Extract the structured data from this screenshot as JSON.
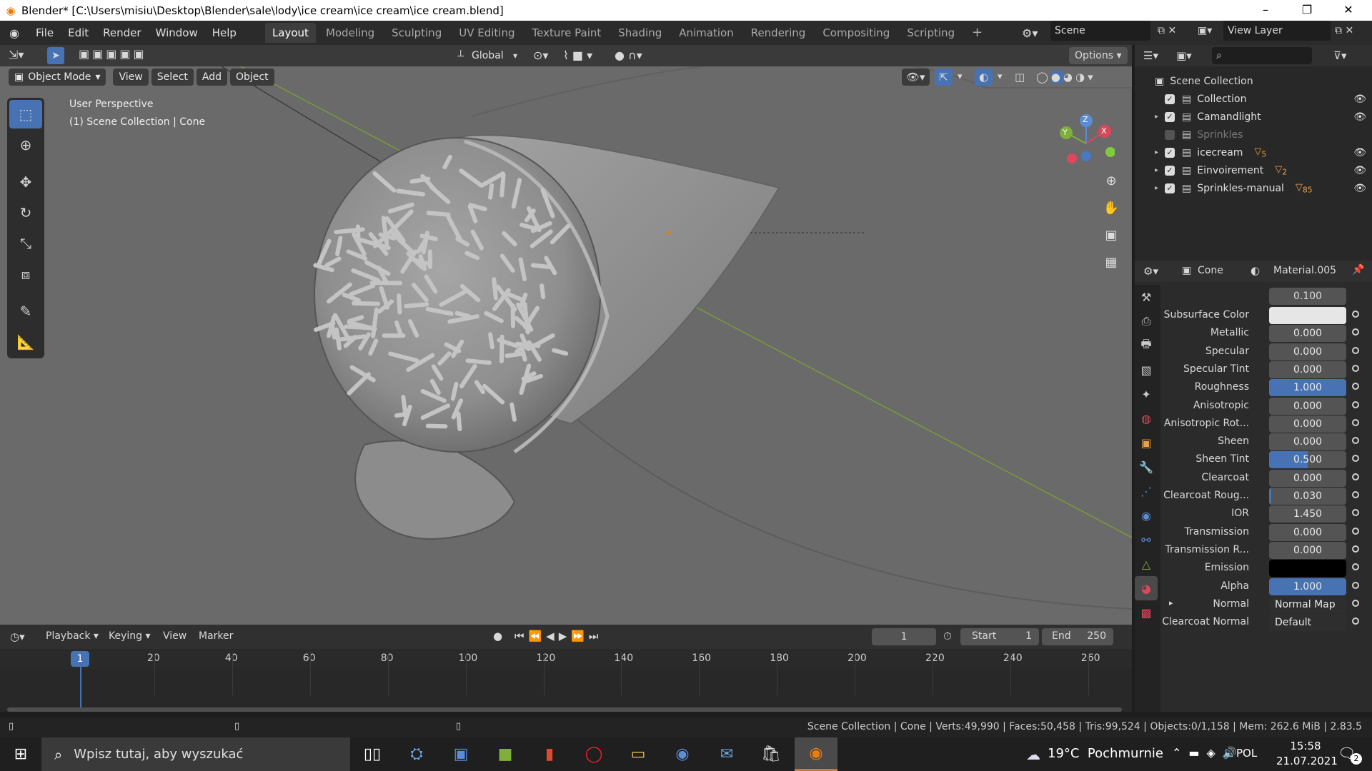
{
  "window": {
    "title": "Blender* [C:\\Users\\misiu\\Desktop\\Blender\\sale\\lody\\ice cream\\ice cream\\ice cream.blend]",
    "minimize": "–",
    "maximize": "❐",
    "close": "✕"
  },
  "menu": {
    "items": [
      "File",
      "Edit",
      "Render",
      "Window",
      "Help"
    ],
    "workspaces": [
      "Layout",
      "Modeling",
      "Sculpting",
      "UV Editing",
      "Texture Paint",
      "Shading",
      "Animation",
      "Rendering",
      "Compositing",
      "Scripting"
    ],
    "active_workspace": "Layout",
    "add_tab": "+",
    "scene_label": "Scene",
    "view_layer_label": "View Layer"
  },
  "viewport_header": {
    "mode": "Object Mode",
    "menus": [
      "View",
      "Select",
      "Add",
      "Object"
    ],
    "transform_orientation": "Global",
    "options": "Options"
  },
  "viewport": {
    "perspective": "User Perspective",
    "context": "(1) Scene Collection | Cone",
    "gizmo": {
      "x": "X",
      "y": "Y",
      "z": "Z"
    }
  },
  "outliner": {
    "root": "Scene Collection",
    "items": [
      {
        "name": "Collection",
        "checked": true,
        "expandable": false,
        "visible": true,
        "badge": ""
      },
      {
        "name": "Camandlight",
        "checked": true,
        "expandable": true,
        "visible": true,
        "badge": ""
      },
      {
        "name": "Sprinkles",
        "checked": false,
        "expandable": false,
        "visible": false,
        "badge": ""
      },
      {
        "name": "icecream",
        "checked": true,
        "expandable": true,
        "visible": true,
        "badge": "5"
      },
      {
        "name": "Einvoirement",
        "checked": true,
        "expandable": true,
        "visible": true,
        "badge": "2"
      },
      {
        "name": "Sprinkles-manual",
        "checked": true,
        "expandable": true,
        "visible": true,
        "badge": "85"
      }
    ]
  },
  "properties": {
    "object": "Cone",
    "material": "Material.005",
    "top_value": "0.100",
    "rows": [
      {
        "label": "Subsurface Color",
        "value": "",
        "type": "color",
        "color": "#e6e6e6"
      },
      {
        "label": "Metallic",
        "value": "0.000",
        "fill": 0
      },
      {
        "label": "Specular",
        "value": "0.000",
        "fill": 0
      },
      {
        "label": "Specular Tint",
        "value": "0.000",
        "fill": 0
      },
      {
        "label": "Roughness",
        "value": "1.000",
        "fill": 1
      },
      {
        "label": "Anisotropic",
        "value": "0.000",
        "fill": 0
      },
      {
        "label": "Anisotropic Rot...",
        "value": "0.000",
        "fill": 0
      },
      {
        "label": "Sheen",
        "value": "0.000",
        "fill": 0
      },
      {
        "label": "Sheen Tint",
        "value": "0.500",
        "fill": 0.5
      },
      {
        "label": "Clearcoat",
        "value": "0.000",
        "fill": 0
      },
      {
        "label": "Clearcoat Roug...",
        "value": "0.030",
        "fill": 0.03
      },
      {
        "label": "IOR",
        "value": "1.450",
        "fill": 0
      },
      {
        "label": "Transmission",
        "value": "0.000",
        "fill": 0
      },
      {
        "label": "Transmission R...",
        "value": "0.000",
        "fill": 0
      },
      {
        "label": "Emission",
        "value": "",
        "type": "color",
        "color": "#000000"
      },
      {
        "label": "Alpha",
        "value": "1.000",
        "fill": 1
      },
      {
        "label": "Normal",
        "value": "Normal Map",
        "type": "link",
        "expand": "▸"
      },
      {
        "label": "Clearcoat Normal",
        "value": "Default",
        "type": "link"
      }
    ]
  },
  "timeline": {
    "menus": [
      "Playback",
      "Keying",
      "View",
      "Marker"
    ],
    "current_frame": "1",
    "start_label": "Start",
    "start": "1",
    "end_label": "End",
    "end": "250",
    "ticks": [
      "20",
      "40",
      "60",
      "80",
      "100",
      "120",
      "140",
      "160",
      "180",
      "200",
      "220",
      "240",
      "260"
    ]
  },
  "status": {
    "text": "Scene Collection | Cone | Verts:49,990 | Faces:50,458 | Tris:99,524 | Objects:0/1,158 | Mem: 262.6 MiB | 2.83.5"
  },
  "taskbar": {
    "search_placeholder": "Wpisz tutaj, aby wyszukać",
    "weather": "19°C  Pochmurnie",
    "language": "POL",
    "time": "15:58",
    "date": "21.07.2021",
    "notifications": "2"
  },
  "colors": {
    "accent": "#4772b3",
    "viewport_bg": "#6a6a6a",
    "object_gray": "#9a9a9a"
  }
}
